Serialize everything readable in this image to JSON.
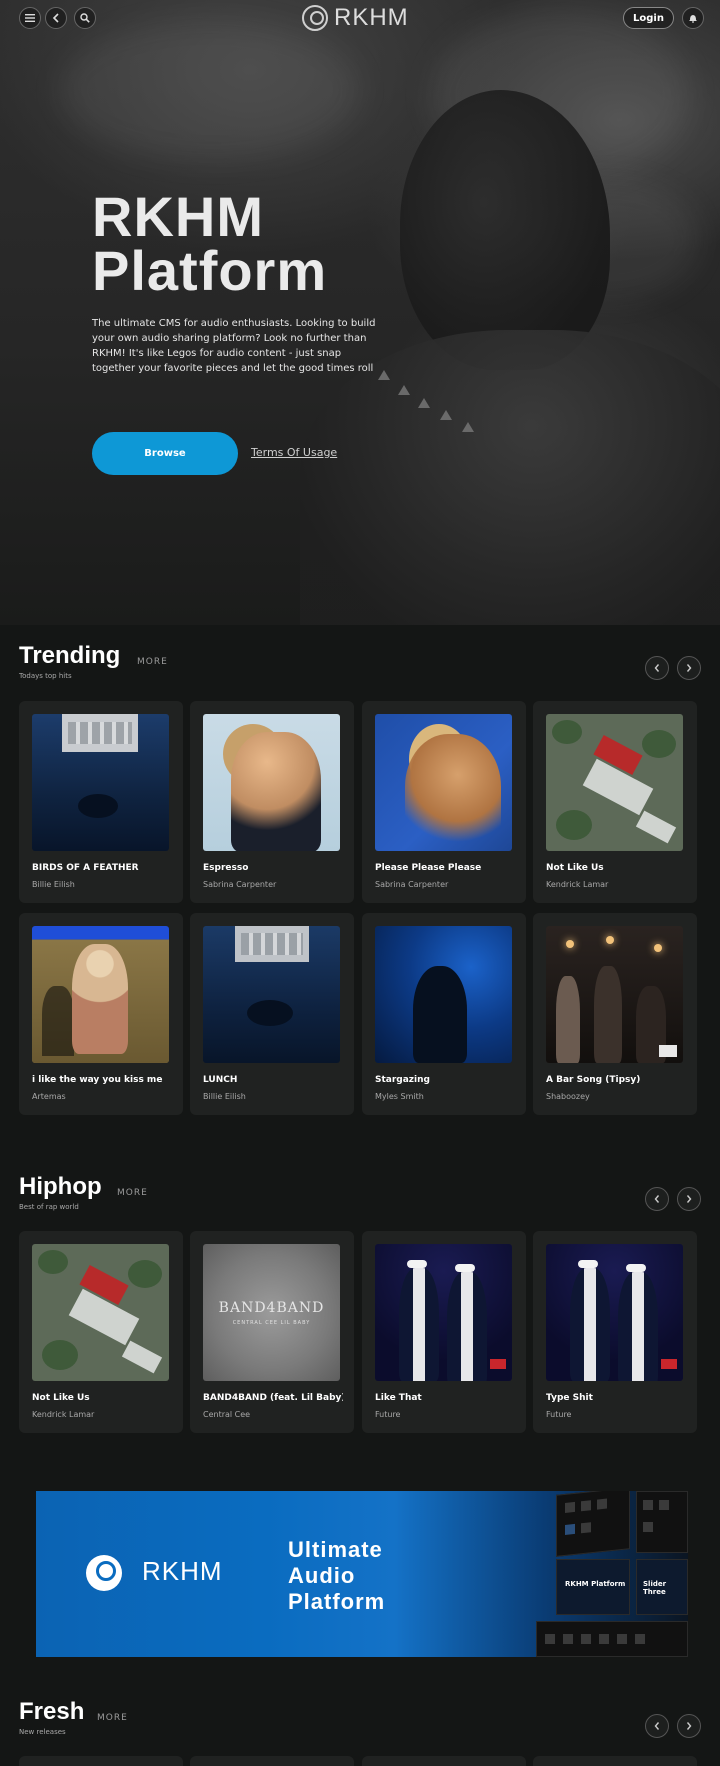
{
  "header": {
    "menu_icon": "menu-icon",
    "back_icon": "chevron-left-icon",
    "search_icon": "search-icon",
    "brand": "RKHM",
    "login_label": "Login",
    "bell_icon": "bell-icon"
  },
  "hero": {
    "title_line1": "RKHM",
    "title_line2": "Platform",
    "description": "The ultimate CMS for audio enthusiasts. Looking to build your own audio sharing platform? Look no further than RKHM! It's like Legos for audio content - just snap together your favorite pieces and let the good times roll",
    "browse_label": "Browse",
    "terms_label": "Terms Of Usage"
  },
  "trending": {
    "title": "Trending",
    "subtitle": "Todays top hits",
    "more_label": "MORE",
    "items": [
      {
        "title": "BIRDS OF A FEATHER",
        "artist": "Billie Eilish"
      },
      {
        "title": "Espresso",
        "artist": "Sabrina Carpenter"
      },
      {
        "title": "Please Please Please",
        "artist": "Sabrina Carpenter"
      },
      {
        "title": "Not Like Us",
        "artist": "Kendrick Lamar"
      },
      {
        "title": "i like the way you kiss me",
        "artist": "Artemas"
      },
      {
        "title": "LUNCH",
        "artist": "Billie Eilish"
      },
      {
        "title": "Stargazing",
        "artist": "Myles Smith"
      },
      {
        "title": "A Bar Song (Tipsy)",
        "artist": "Shaboozey"
      }
    ]
  },
  "hiphop": {
    "title": "Hiphop",
    "subtitle": "Best of rap world",
    "more_label": "MORE",
    "items": [
      {
        "title": "Not Like Us",
        "artist": "Kendrick Lamar"
      },
      {
        "title": "BAND4BAND (feat. Lil Baby)",
        "artist": "Central Cee",
        "cover_text": "BAND4BAND",
        "cover_subtext": "CENTRAL CEE   LIL BABY"
      },
      {
        "title": "Like That",
        "artist": "Future"
      },
      {
        "title": "Type Shit",
        "artist": "Future"
      }
    ]
  },
  "banner": {
    "brand": "RKHM",
    "headline_line1": "Ultimate",
    "headline_line2": "Audio",
    "headline_line3": "Platform",
    "shot_label1": "RKHM Platform",
    "shot_label2": "Slider Three"
  },
  "fresh": {
    "title": "Fresh",
    "subtitle": "New releases",
    "more_label": "MORE"
  },
  "colors": {
    "accent": "#0e98d6",
    "background": "#141615",
    "card": "#202221"
  }
}
